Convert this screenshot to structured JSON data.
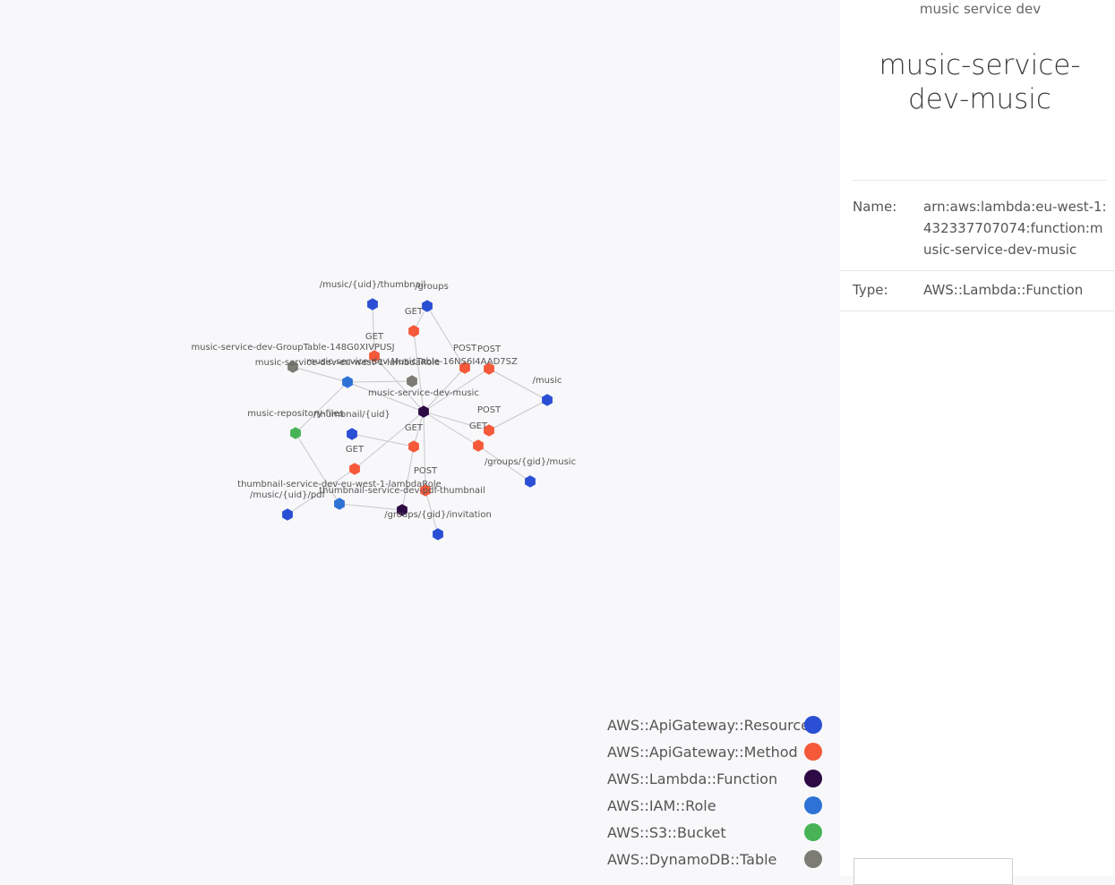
{
  "graph": {
    "nodes": [
      {
        "id": "n1",
        "label": "/music/{uid}/thumbnail",
        "type": "AWS::ApiGateway::Resource"
      },
      {
        "id": "n2",
        "label": "/groups",
        "type": "AWS::ApiGateway::Resource"
      },
      {
        "id": "n3",
        "label": "GET",
        "type": "AWS::ApiGateway::Method"
      },
      {
        "id": "n4",
        "label": "GET",
        "type": "AWS::ApiGateway::Method"
      },
      {
        "id": "n5",
        "label": "music-service-dev-GroupTable-148G0XIVPUSJ",
        "type": "AWS::DynamoDB::Table"
      },
      {
        "id": "n6",
        "label": "POST",
        "type": "AWS::ApiGateway::Method"
      },
      {
        "id": "n7",
        "label": "POST",
        "type": "AWS::ApiGateway::Method"
      },
      {
        "id": "n8",
        "label": "music-service-dev-MusicTable-16NS6I4AAD7SZ",
        "type": "AWS::DynamoDB::Table"
      },
      {
        "id": "n9",
        "label": "music-service-dev-eu-west-1-lambdaRole",
        "type": "AWS::IAM::Role"
      },
      {
        "id": "n10",
        "label": "music-service-dev-music",
        "type": "AWS::Lambda::Function"
      },
      {
        "id": "n11",
        "label": "/music",
        "type": "AWS::ApiGateway::Resource"
      },
      {
        "id": "n12",
        "label": "music-repository-files",
        "type": "AWS::S3::Bucket"
      },
      {
        "id": "n13",
        "label": "/thumbnail/{uid}",
        "type": "AWS::ApiGateway::Resource"
      },
      {
        "id": "n14",
        "label": "GET",
        "type": "AWS::ApiGateway::Method"
      },
      {
        "id": "n15",
        "label": "GET",
        "type": "AWS::ApiGateway::Method"
      },
      {
        "id": "n16",
        "label": "POST",
        "type": "AWS::ApiGateway::Method"
      },
      {
        "id": "n17",
        "label": "GET",
        "type": "AWS::ApiGateway::Method"
      },
      {
        "id": "n18",
        "label": "/groups/{gid}/music",
        "type": "AWS::ApiGateway::Resource"
      },
      {
        "id": "n19",
        "label": "POST",
        "type": "AWS::ApiGateway::Method"
      },
      {
        "id": "n20",
        "label": "thumbnail-service-dev-eu-west-1-lambdaRole",
        "type": "AWS::IAM::Role"
      },
      {
        "id": "n21",
        "label": "thumbnail-service-dev-pdf-thumbnail",
        "type": "AWS::Lambda::Function"
      },
      {
        "id": "n22",
        "label": "/music/{uid}/pdf",
        "type": "AWS::ApiGateway::Resource"
      },
      {
        "id": "n23",
        "label": "/groups/{gid}/invitation",
        "type": "AWS::ApiGateway::Resource"
      }
    ],
    "edges": [
      [
        "n1",
        "n4"
      ],
      [
        "n2",
        "n3"
      ],
      [
        "n2",
        "n6"
      ],
      [
        "n3",
        "n10"
      ],
      [
        "n4",
        "n10"
      ],
      [
        "n5",
        "n9"
      ],
      [
        "n8",
        "n9"
      ],
      [
        "n9",
        "n10"
      ],
      [
        "n6",
        "n10"
      ],
      [
        "n7",
        "n10"
      ],
      [
        "n7",
        "n11"
      ],
      [
        "n11",
        "n16"
      ],
      [
        "n16",
        "n10"
      ],
      [
        "n13",
        "n14"
      ],
      [
        "n14",
        "n10"
      ],
      [
        "n15",
        "n10"
      ],
      [
        "n15",
        "n22"
      ],
      [
        "n12",
        "n9"
      ],
      [
        "n12",
        "n20"
      ],
      [
        "n17",
        "n10"
      ],
      [
        "n17",
        "n18"
      ],
      [
        "n19",
        "n10"
      ],
      [
        "n19",
        "n23"
      ],
      [
        "n21",
        "n20"
      ],
      [
        "n14",
        "n21"
      ]
    ]
  },
  "legend": [
    {
      "label": "AWS::ApiGateway::Resource",
      "color": "#2a4fd4"
    },
    {
      "label": "AWS::ApiGateway::Method",
      "color": "#f5593a"
    },
    {
      "label": "AWS::Lambda::Function",
      "color": "#2e0a45"
    },
    {
      "label": "AWS::IAM::Role",
      "color": "#2f72d6"
    },
    {
      "label": "AWS::S3::Bucket",
      "color": "#47b356"
    },
    {
      "label": "AWS::DynamoDB::Table",
      "color": "#7c7b74"
    }
  ],
  "panel": {
    "subtitle": "music service dev",
    "title": "music-service-dev-music",
    "props": [
      {
        "key": "Name:",
        "value": "arn:aws:lambda:eu-west-1:432337707074:function:music-service-dev-music"
      },
      {
        "key": "Type:",
        "value": "AWS::Lambda::Function"
      }
    ]
  }
}
